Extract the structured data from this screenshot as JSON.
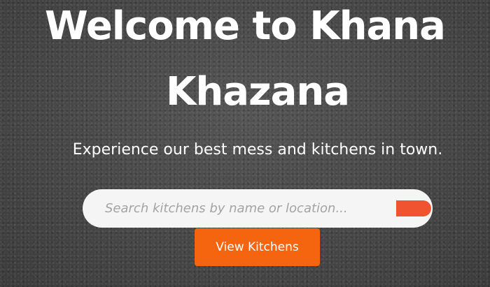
{
  "hero": {
    "title_line1": "Welcome to Khana",
    "title_line2": "Khazana",
    "tagline": "Experience our best mess and kitchens in town."
  },
  "search": {
    "placeholder": "Search kitchens by name or location...",
    "button_icon": "search-submit",
    "button_color": "#f0532f"
  },
  "cta": {
    "label": "View Kitchens",
    "color": "#f5640f"
  }
}
